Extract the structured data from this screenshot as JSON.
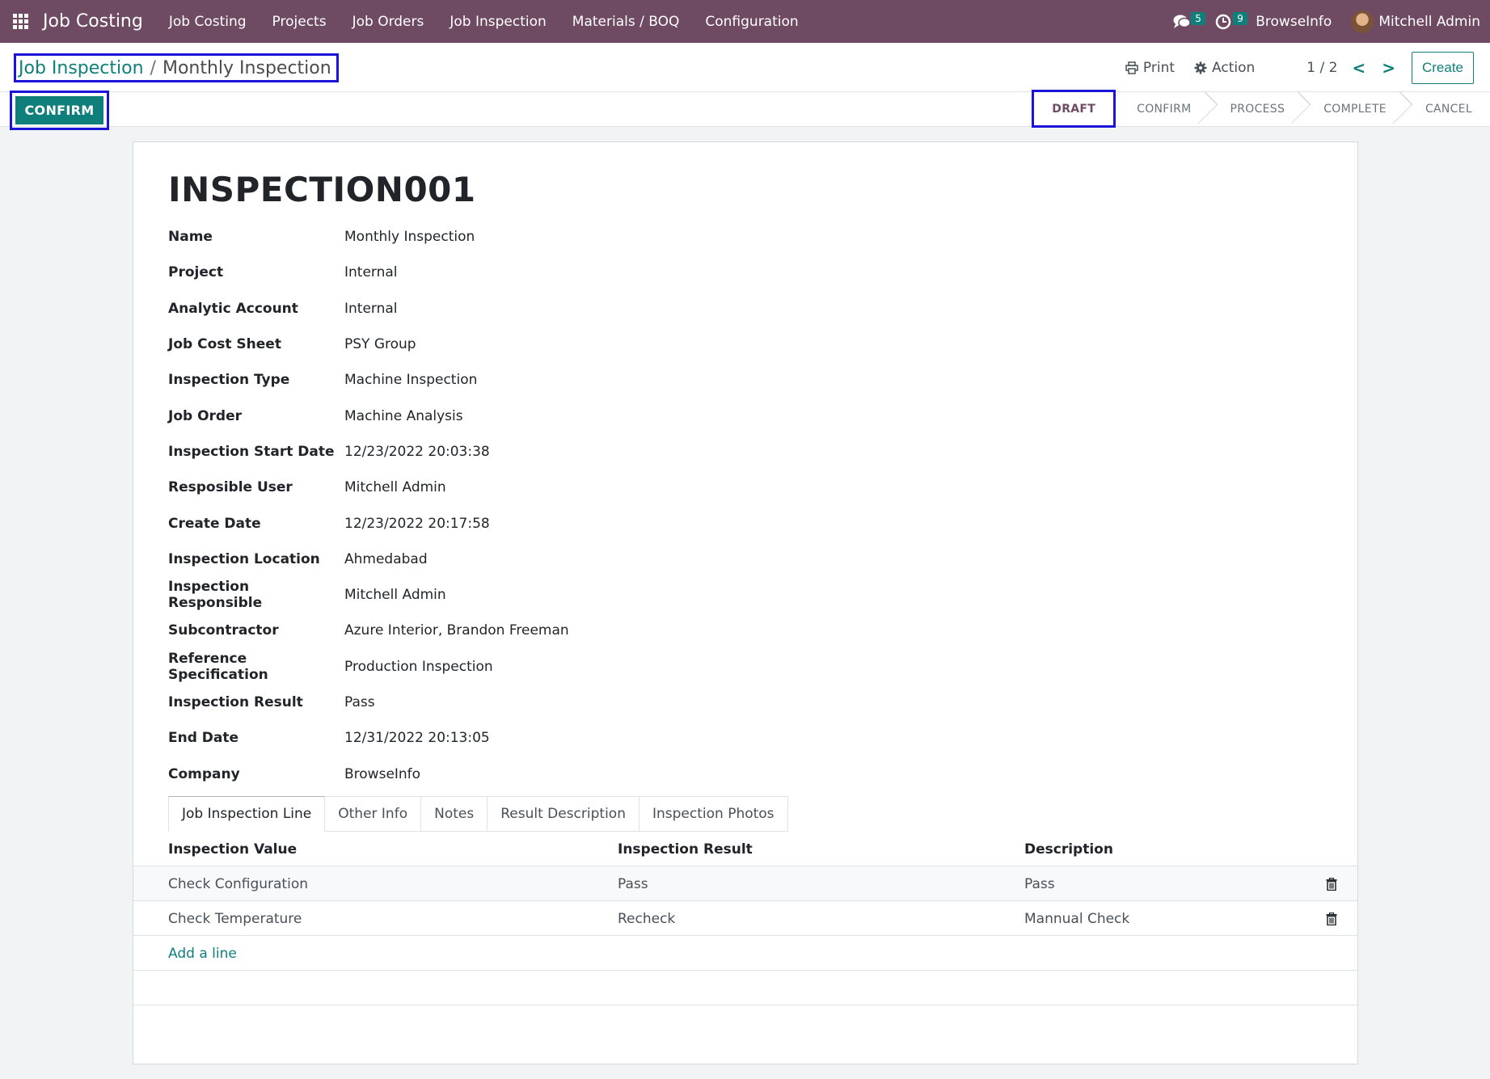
{
  "navbar": {
    "brand": "Job Costing",
    "menu": [
      "Job Costing",
      "Projects",
      "Job Orders",
      "Job Inspection",
      "Materials / BOQ",
      "Configuration"
    ],
    "messages_count": "5",
    "activities_count": "9",
    "company": "BrowseInfo",
    "user": "Mitchell Admin",
    "icons": {
      "apps": "apps-grid-icon",
      "messages": "chat-icon",
      "activities": "clock-icon"
    }
  },
  "breadcrumb": {
    "parent": "Job Inspection",
    "separator": "/",
    "current": "Monthly Inspection"
  },
  "toolbar": {
    "print_label": "Print",
    "action_label": "Action",
    "pager": "1 / 2",
    "prev": "<",
    "next": ">",
    "create_label": "Create"
  },
  "statusbar": {
    "confirm_button": "CONFIRM",
    "stages": [
      "DRAFT",
      "CONFIRM",
      "PROCESS",
      "COMPLETE",
      "CANCEL"
    ],
    "active_stage": "DRAFT"
  },
  "record": {
    "title": "INSPECTION001",
    "fields": [
      {
        "label": "Name",
        "value": "Monthly Inspection"
      },
      {
        "label": "Project",
        "value": "Internal"
      },
      {
        "label": "Analytic Account",
        "value": "Internal"
      },
      {
        "label": "Job Cost Sheet",
        "value": "PSY Group"
      },
      {
        "label": "Inspection Type",
        "value": "Machine Inspection"
      },
      {
        "label": "Job Order",
        "value": "Machine Analysis"
      },
      {
        "label": "Inspection Start Date",
        "value": "12/23/2022 20:03:38"
      },
      {
        "label": "Resposible User",
        "value": "Mitchell Admin"
      },
      {
        "label": "Create Date",
        "value": "12/23/2022 20:17:58"
      },
      {
        "label": "Inspection Location",
        "value": "Ahmedabad"
      },
      {
        "label": "Inspection Responsible",
        "value": "Mitchell Admin"
      },
      {
        "label": "Subcontractor",
        "value": "Azure Interior, Brandon Freeman"
      },
      {
        "label": "Reference Specification",
        "value": "Production Inspection"
      },
      {
        "label": "Inspection Result",
        "value": "Pass"
      },
      {
        "label": "End Date",
        "value": "12/31/2022 20:13:05"
      },
      {
        "label": "Company",
        "value": "BrowseInfo"
      }
    ]
  },
  "tabs": [
    "Job Inspection Line",
    "Other Info",
    "Notes",
    "Result Description",
    "Inspection Photos"
  ],
  "lines": {
    "headers": [
      "Inspection Value",
      "Inspection Result",
      "Description"
    ],
    "rows": [
      [
        "Check Configuration",
        "Pass",
        "Pass"
      ],
      [
        "Check Temperature",
        "Recheck",
        "Mannual Check"
      ]
    ],
    "add_line": "Add a line"
  },
  "colors": {
    "navbar": "#6f4a63",
    "accent": "#0f7f7b",
    "highlight_border": "#1a14d6"
  }
}
